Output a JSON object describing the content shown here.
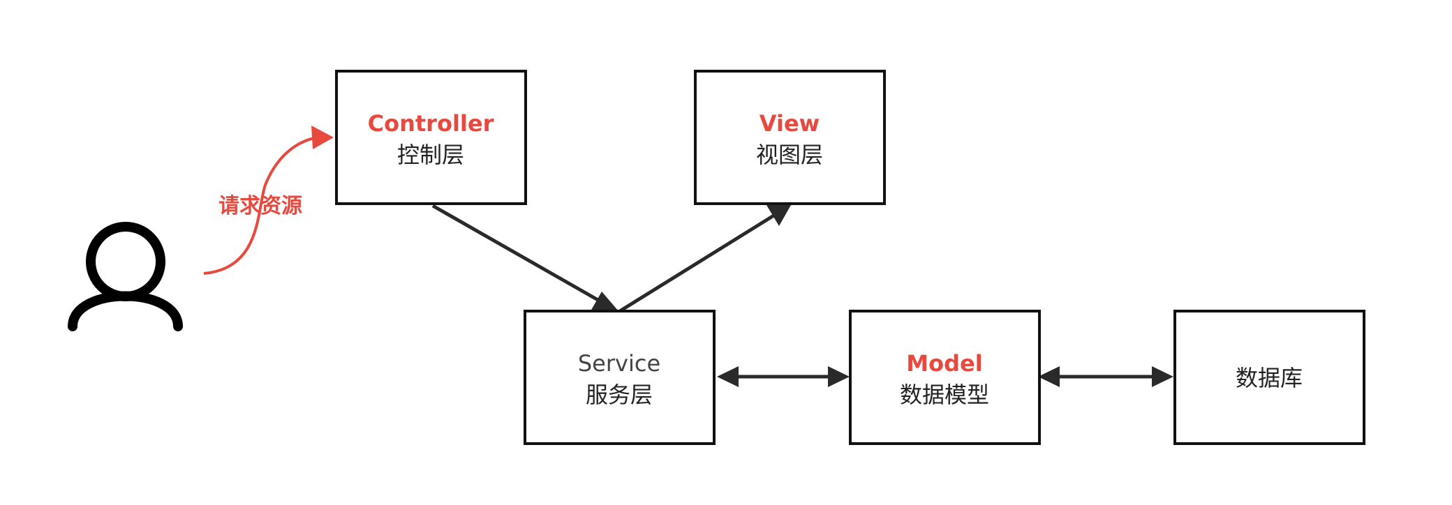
{
  "diagram": {
    "nodes": {
      "controller": {
        "title": "Controller",
        "subtitle": "控制层"
      },
      "view": {
        "title": "View",
        "subtitle": "视图层"
      },
      "service": {
        "title": "Service",
        "subtitle": "服务层"
      },
      "model": {
        "title": "Model",
        "subtitle": "数据模型"
      },
      "database": {
        "title": "",
        "subtitle": "数据库"
      }
    },
    "request_label": "请求资源"
  },
  "colors": {
    "accent": "#e8493e",
    "stroke": "#111111",
    "text": "#222222"
  }
}
